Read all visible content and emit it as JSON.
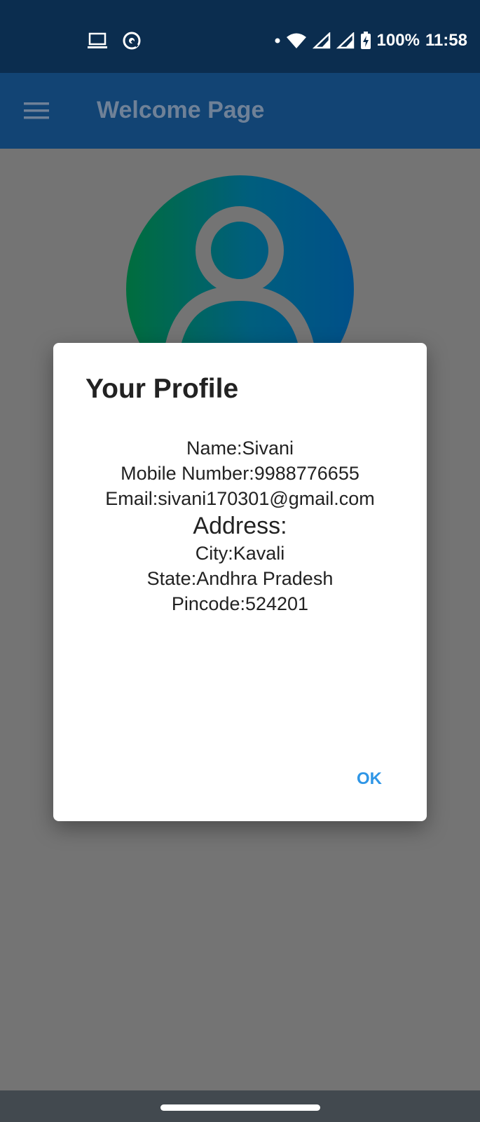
{
  "status_bar": {
    "battery_percent": "100%",
    "time": "11:58",
    "icons": [
      "laptop-icon",
      "data-saver-icon",
      "dot-icon",
      "wifi-icon",
      "signal-icon",
      "signal-icon",
      "battery-charging-icon"
    ]
  },
  "app_bar": {
    "title": "Welcome Page",
    "menu_icon": "hamburger-menu-icon"
  },
  "avatar": {
    "icon": "person-icon"
  },
  "dialog": {
    "title": "Your Profile",
    "name_line": "Name:Sivani",
    "mobile_line": "Mobile Number:9988776655",
    "email_line": "Email:sivani170301@gmail.com",
    "address_heading": "Address:",
    "city_line": "City:Kavali",
    "state_line": "State:Andhra Pradesh",
    "pincode_line": "Pincode:524201",
    "ok_label": "OK"
  },
  "colors": {
    "status_bar_bg": "#0b2d4f",
    "app_bar_bg": "#124474",
    "scrim_bg": "#747474",
    "accent": "#2f96e6"
  }
}
